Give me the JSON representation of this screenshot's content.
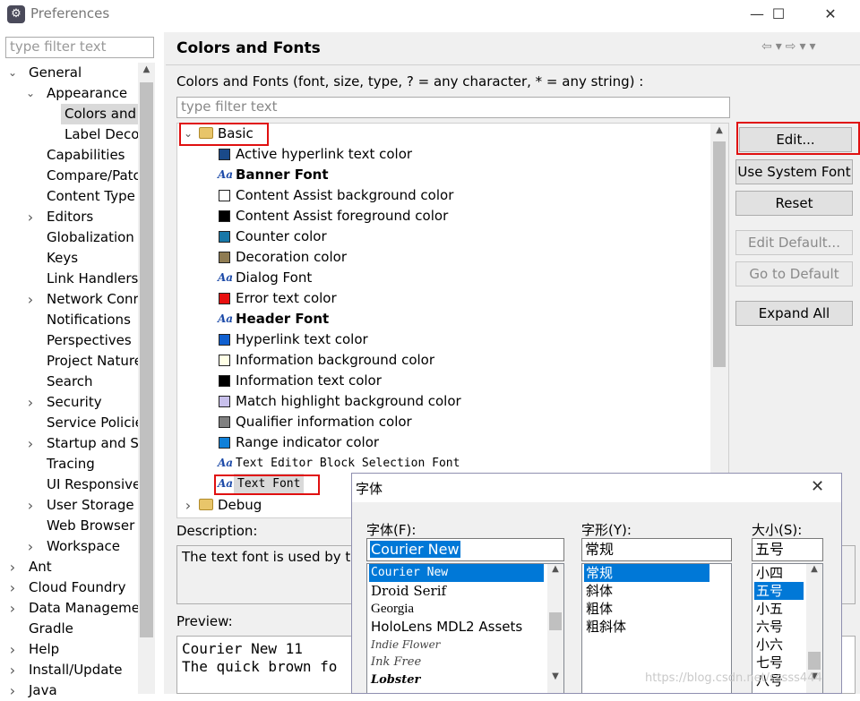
{
  "window": {
    "title": "Preferences",
    "icon": "eclipse-icon",
    "minimize": "—",
    "maximize": "☐",
    "close": "✕"
  },
  "left": {
    "filter_placeholder": "type filter text",
    "tree": [
      {
        "label": "General",
        "depth": 0,
        "twisty": "expanded"
      },
      {
        "label": "Appearance",
        "depth": 1,
        "twisty": "expanded"
      },
      {
        "label": "Colors and",
        "depth": 2,
        "twisty": "none",
        "selected": true
      },
      {
        "label": "Label Deco",
        "depth": 2,
        "twisty": "none"
      },
      {
        "label": "Capabilities",
        "depth": 1,
        "twisty": "none"
      },
      {
        "label": "Compare/Patc",
        "depth": 1,
        "twisty": "none"
      },
      {
        "label": "Content Type",
        "depth": 1,
        "twisty": "none"
      },
      {
        "label": "Editors",
        "depth": 1,
        "twisty": "collapsed"
      },
      {
        "label": "Globalization",
        "depth": 1,
        "twisty": "none"
      },
      {
        "label": "Keys",
        "depth": 1,
        "twisty": "none"
      },
      {
        "label": "Link Handlers",
        "depth": 1,
        "twisty": "none"
      },
      {
        "label": "Network Conr",
        "depth": 1,
        "twisty": "collapsed"
      },
      {
        "label": "Notifications",
        "depth": 1,
        "twisty": "none"
      },
      {
        "label": "Perspectives",
        "depth": 1,
        "twisty": "none"
      },
      {
        "label": "Project Nature",
        "depth": 1,
        "twisty": "none"
      },
      {
        "label": "Search",
        "depth": 1,
        "twisty": "none"
      },
      {
        "label": "Security",
        "depth": 1,
        "twisty": "collapsed"
      },
      {
        "label": "Service Policie",
        "depth": 1,
        "twisty": "none"
      },
      {
        "label": "Startup and Sh",
        "depth": 1,
        "twisty": "collapsed"
      },
      {
        "label": "Tracing",
        "depth": 1,
        "twisty": "none"
      },
      {
        "label": "UI Responsive",
        "depth": 1,
        "twisty": "none"
      },
      {
        "label": "User Storage",
        "depth": 1,
        "twisty": "collapsed"
      },
      {
        "label": "Web Browser",
        "depth": 1,
        "twisty": "none"
      },
      {
        "label": "Workspace",
        "depth": 1,
        "twisty": "collapsed"
      },
      {
        "label": "Ant",
        "depth": 0,
        "twisty": "collapsed"
      },
      {
        "label": "Cloud Foundry",
        "depth": 0,
        "twisty": "collapsed"
      },
      {
        "label": "Data Manageme",
        "depth": 0,
        "twisty": "collapsed"
      },
      {
        "label": "Gradle",
        "depth": 0,
        "twisty": "none"
      },
      {
        "label": "Help",
        "depth": 0,
        "twisty": "collapsed"
      },
      {
        "label": "Install/Update",
        "depth": 0,
        "twisty": "collapsed"
      },
      {
        "label": "Java",
        "depth": 0,
        "twisty": "collapsed"
      }
    ]
  },
  "main": {
    "title": "Colors and Fonts",
    "help": "Colors and Fonts (font, size, type, ? = any character, * = any string) :",
    "filter_placeholder": "type filter text",
    "category": "Basic",
    "items": [
      {
        "label": "Active hyperlink text color",
        "kind": "color",
        "color": "#1a4a8a"
      },
      {
        "label": "Banner Font",
        "kind": "font",
        "bold": true
      },
      {
        "label": "Content Assist background color",
        "kind": "color",
        "color": "#ffffff"
      },
      {
        "label": "Content Assist foreground color",
        "kind": "color",
        "color": "#000000"
      },
      {
        "label": "Counter color",
        "kind": "color",
        "color": "#1878a8"
      },
      {
        "label": "Decoration color",
        "kind": "color",
        "color": "#8f7c52"
      },
      {
        "label": "Dialog Font",
        "kind": "font"
      },
      {
        "label": "Error text color",
        "kind": "color",
        "color": "#e81010"
      },
      {
        "label": "Header Font",
        "kind": "font",
        "bold": true
      },
      {
        "label": "Hyperlink text color",
        "kind": "color",
        "color": "#1060d0"
      },
      {
        "label": "Information background color",
        "kind": "color",
        "color": "#ffffe6"
      },
      {
        "label": "Information text color",
        "kind": "color",
        "color": "#000000"
      },
      {
        "label": "Match highlight background color",
        "kind": "color",
        "color": "#c8c0ec"
      },
      {
        "label": "Qualifier information color",
        "kind": "color",
        "color": "#808080"
      },
      {
        "label": "Range indicator color",
        "kind": "color",
        "color": "#1080d8"
      },
      {
        "label": "Text Editor Block Selection Font",
        "kind": "font",
        "mono": true
      },
      {
        "label": "Text Font",
        "kind": "font",
        "mono": true,
        "selected": true
      }
    ],
    "next_category": "Debug",
    "buttons": {
      "edit": "Edit...",
      "use_system_font": "Use System Font",
      "reset": "Reset",
      "edit_default": "Edit Default...",
      "go_to_default": "Go to Default",
      "expand_all": "Expand All"
    },
    "description_label": "Description:",
    "description_text": "The text font is used by te",
    "preview_label": "Preview:",
    "preview_text": "Courier New 11\nThe quick brown fo"
  },
  "font_dialog": {
    "title": "字体",
    "close": "✕",
    "font_label": "字体(F):",
    "font_value": "Courier New",
    "fonts": [
      "Courier New",
      "Droid Serif",
      "Georgia",
      "HoloLens MDL2 Assets",
      "Indie Flower",
      "Ink Free",
      "Lobster"
    ],
    "style_label": "字形(Y):",
    "style_value": "常规",
    "styles": [
      "常规",
      "斜体",
      "粗体",
      "粗斜体"
    ],
    "size_label": "大小(S):",
    "size_value": "五号",
    "sizes": [
      "小四",
      "五号",
      "小五",
      "六号",
      "小六",
      "七号",
      "八号"
    ]
  },
  "watermark": "https://blog.csdn.net/sssss444"
}
